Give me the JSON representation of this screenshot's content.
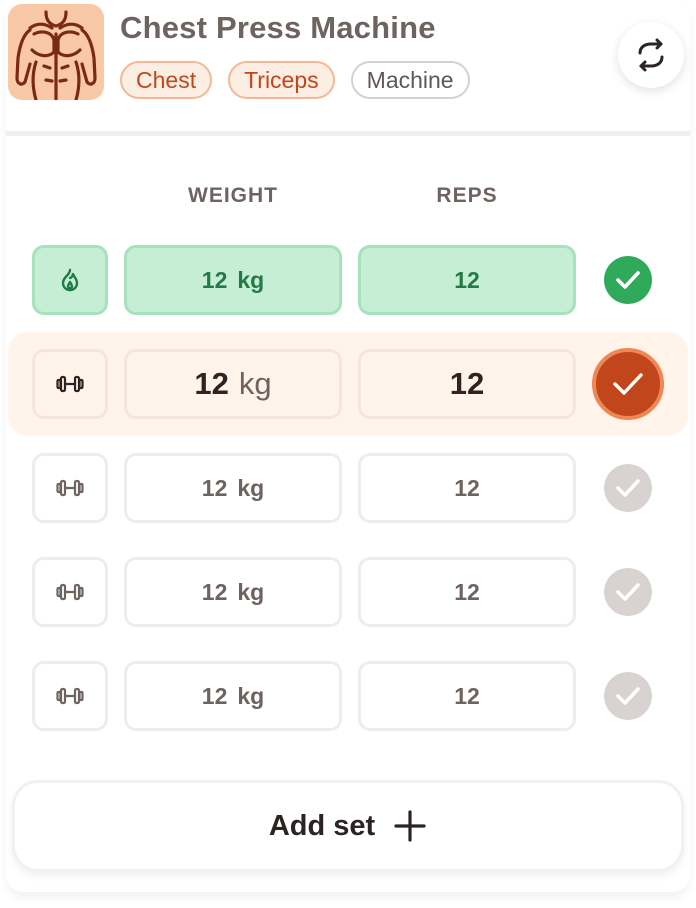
{
  "exercise": {
    "title": "Chest Press Machine",
    "muscle_tags": [
      "Chest",
      "Triceps"
    ],
    "equipment_tag": "Machine",
    "thumbnail_icon": "chest-muscles-icon",
    "swap_icon": "swap-arrows-icon"
  },
  "columns": {
    "weight": "WEIGHT",
    "reps": "REPS"
  },
  "sets": [
    {
      "status": "done",
      "type_icon": "flame-icon",
      "weight": "12",
      "weight_unit": "kg",
      "reps": "12"
    },
    {
      "status": "active",
      "type_icon": "dumbbell-icon",
      "weight": "12",
      "weight_unit": "kg",
      "reps": "12"
    },
    {
      "status": "pending",
      "type_icon": "dumbbell-icon",
      "weight": "12",
      "weight_unit": "kg",
      "reps": "12"
    },
    {
      "status": "pending",
      "type_icon": "dumbbell-icon",
      "weight": "12",
      "weight_unit": "kg",
      "reps": "12"
    },
    {
      "status": "pending",
      "type_icon": "dumbbell-icon",
      "weight": "12",
      "weight_unit": "kg",
      "reps": "12"
    }
  ],
  "add_set": {
    "label": "Add set",
    "icon": "plus-icon"
  },
  "colors": {
    "accent": "#c2461b",
    "accent_light": "#fdeee3",
    "done_green": "#2fa95a",
    "done_fill": "#c5eed4",
    "muted_check": "#d8d3d1",
    "text_muted": "#6d6360"
  }
}
